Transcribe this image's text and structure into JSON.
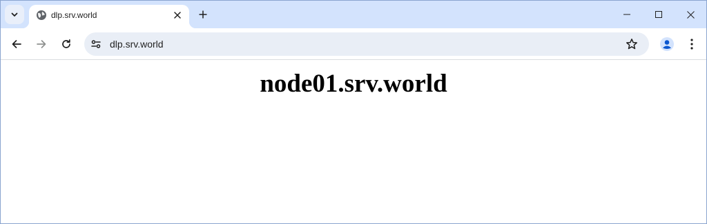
{
  "browser": {
    "tab": {
      "title": "dlp.srv.world",
      "favicon": "globe-icon"
    },
    "address_bar": {
      "url": "dlp.srv.world"
    },
    "colors": {
      "tabstrip_bg": "#d3e3fd",
      "omnibox_bg": "#e9eef6",
      "profile_accent": "#0b57d0"
    }
  },
  "page": {
    "heading": "node01.srv.world"
  }
}
